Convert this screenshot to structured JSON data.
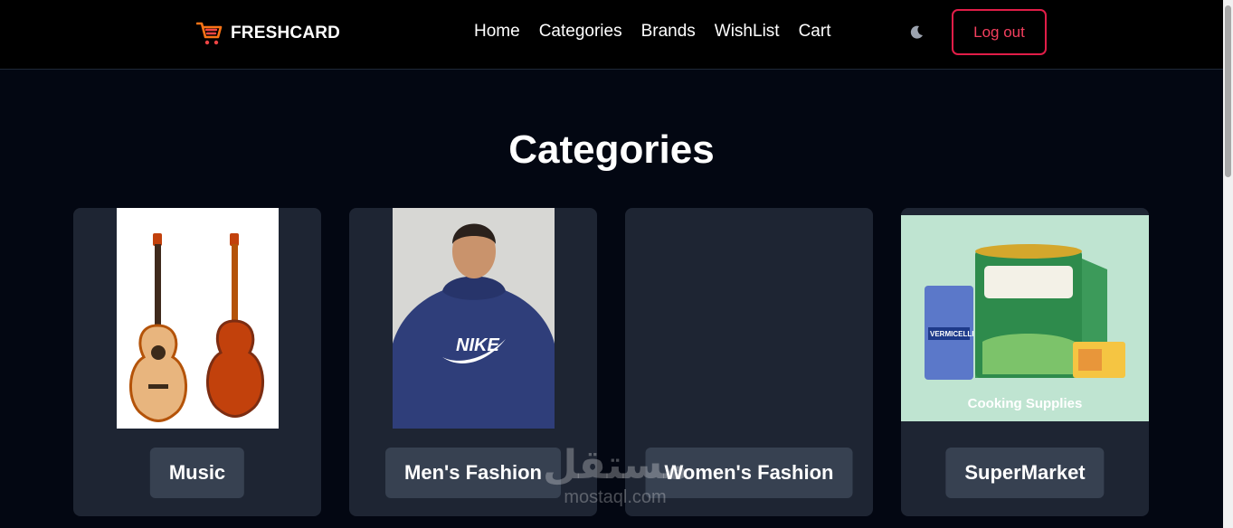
{
  "brand": {
    "name": "FRESHCARD",
    "icon": "cart-icon",
    "accent": "#f97316"
  },
  "nav": {
    "links": [
      "Home",
      "Categories",
      "Brands",
      "WishList",
      "Cart"
    ],
    "theme_icon": "moon-icon",
    "logout_label": "Log out",
    "logout_color": "#e11d48"
  },
  "main": {
    "title": "Categories",
    "categories": [
      {
        "label": "Music",
        "image": "guitar-image"
      },
      {
        "label": "Men's Fashion",
        "image": "hoodie-image"
      },
      {
        "label": "Women's Fashion",
        "image": ""
      },
      {
        "label": "SuperMarket",
        "image": "grocery-image",
        "image_caption": "Cooking Supplies"
      }
    ]
  },
  "watermark": {
    "arabic": "مستقل",
    "latin": "mostaql.com"
  },
  "colors": {
    "background": "#030712",
    "navbar": "#000000",
    "card": "#1e2533",
    "label_bg": "#374151"
  }
}
